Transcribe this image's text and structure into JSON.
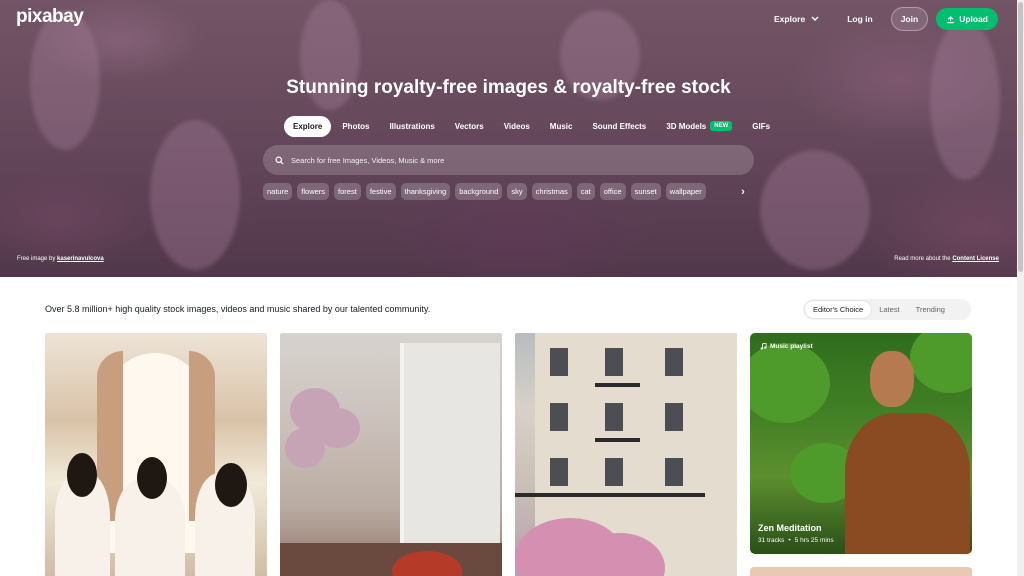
{
  "header": {
    "logo": "pixabay",
    "nav": {
      "explore": "Explore",
      "login": "Log in",
      "join": "Join",
      "upload": "Upload"
    }
  },
  "hero": {
    "title": "Stunning royalty-free images & royalty-free stock",
    "tabs": [
      {
        "label": "Explore",
        "active": true
      },
      {
        "label": "Photos"
      },
      {
        "label": "Illustrations"
      },
      {
        "label": "Vectors"
      },
      {
        "label": "Videos"
      },
      {
        "label": "Music"
      },
      {
        "label": "Sound Effects"
      },
      {
        "label": "3D Models",
        "badge": "NEW"
      },
      {
        "label": "GIFs"
      }
    ],
    "search_placeholder": "Search for free Images, Videos, Music & more",
    "chips": [
      "nature",
      "flowers",
      "forest",
      "festive",
      "thanksgiving",
      "background",
      "sky",
      "christmas",
      "cat",
      "office",
      "sunset",
      "wallpaper"
    ],
    "credit_prefix": "Free image by",
    "credit_author": "kaserinavulcova",
    "license_prefix": "Read more about the",
    "license_link": "Content License"
  },
  "content": {
    "tagline": "Over 5.8 million+ high quality stock images, videos and music shared by our talented community.",
    "filters": [
      "Editor's Choice",
      "Latest",
      "Trending"
    ],
    "active_filter": "Editor's Choice",
    "music_card": {
      "tag": "Music playlist",
      "title": "Zen Meditation",
      "tracks": "31 tracks",
      "separator": "•",
      "duration": "5 hrs 25 mins"
    }
  },
  "colors": {
    "accent": "#02be6e",
    "text": "#191b26"
  }
}
